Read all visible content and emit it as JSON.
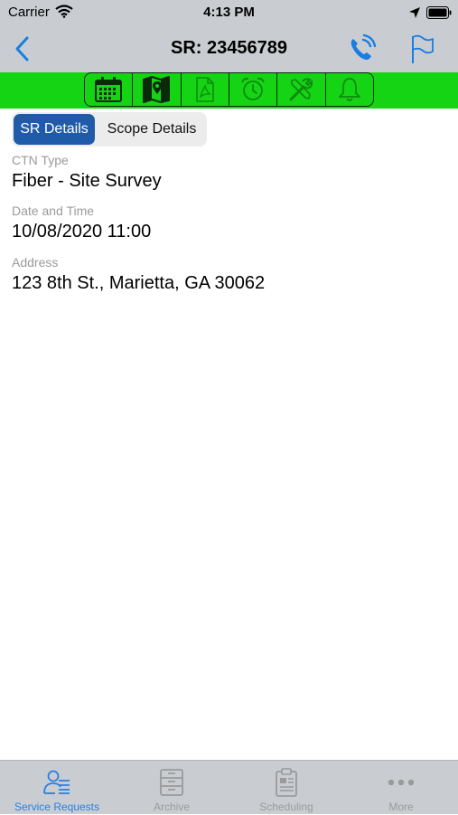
{
  "status_bar": {
    "carrier": "Carrier",
    "time": "4:13 PM",
    "icons": [
      "wifi-icon",
      "location-arrow-icon",
      "battery-icon"
    ]
  },
  "nav": {
    "title": "SR: 23456789",
    "icons": [
      "chevron-left-icon",
      "phone-call-icon",
      "flag-icon"
    ]
  },
  "toolbar": {
    "icons": [
      "calendar-icon",
      "map-icon",
      "pdf-icon",
      "alarm-clock-icon",
      "tools-icon",
      "bell-icon"
    ],
    "enabled": [
      true,
      true,
      false,
      false,
      false,
      false
    ]
  },
  "segments": {
    "sr_details": "SR Details",
    "scope_details": "Scope Details",
    "selected": "SR Details"
  },
  "fields": {
    "ctn_type_label": "CTN Type",
    "ctn_type_value": "Fiber - Site Survey",
    "datetime_label": "Date and Time",
    "datetime_value": "10/08/2020 11:00",
    "address_label": "Address",
    "address_value": "123 8th St., Marietta, GA 30062"
  },
  "tab_bar": {
    "items": [
      {
        "label": "Service Requests",
        "icon": "service-requests-icon",
        "active": true
      },
      {
        "label": "Archive",
        "icon": "archive-icon",
        "active": false
      },
      {
        "label": "Scheduling",
        "icon": "clipboard-icon",
        "active": false
      },
      {
        "label": "More",
        "icon": "more-dots-icon",
        "active": false
      }
    ]
  },
  "colors": {
    "bars": "#c9cdd2",
    "green_bar": "#14d414",
    "segment_selected": "#1f5ba8",
    "accent_blue": "#2b7fe0"
  }
}
